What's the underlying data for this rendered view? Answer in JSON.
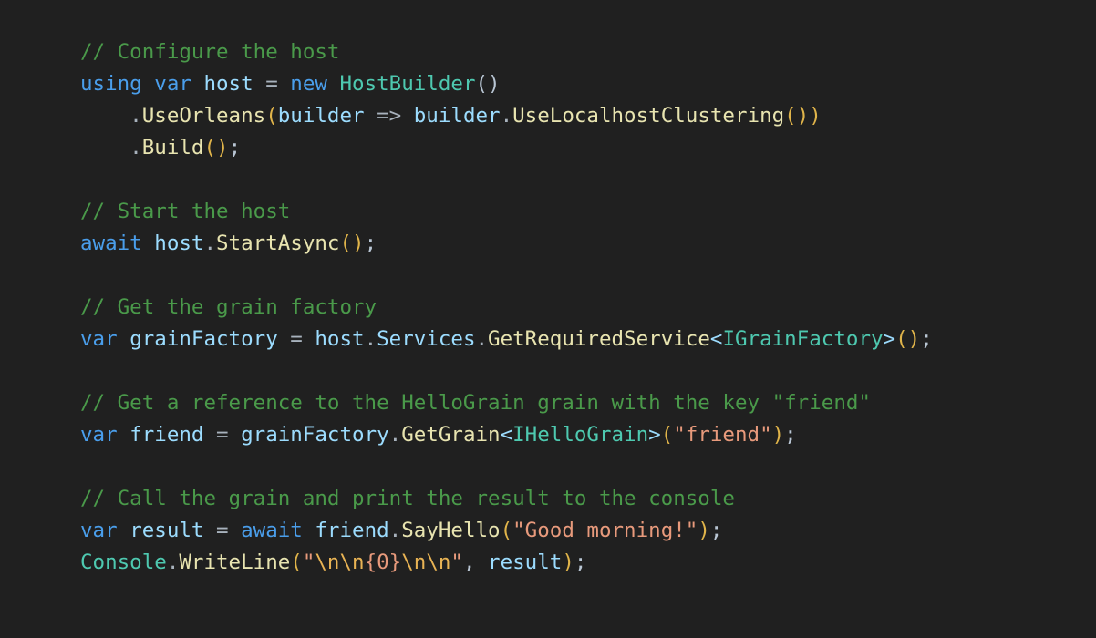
{
  "editor": {
    "background_color": "#202020",
    "language": "csharp",
    "palette": {
      "comment": "#4a9a4a",
      "keyword": "#4a9eeb",
      "variable": "#9cdcfe",
      "type": "#4ec9b0",
      "method": "#e8e4b0",
      "string": "#e89a7c",
      "escape": "#e8b354",
      "paren": "#e0b44a",
      "punctuation": "#b9c6d4",
      "operator": "#a8b2bd"
    }
  },
  "code": {
    "lines": [
      {
        "id": "line-1",
        "tokens": [
          {
            "t": "// Configure the host",
            "c": "comment"
          }
        ]
      },
      {
        "id": "line-2",
        "tokens": [
          {
            "t": "using",
            "c": "keyword"
          },
          {
            "t": " ",
            "c": "plain"
          },
          {
            "t": "var",
            "c": "keyword"
          },
          {
            "t": " ",
            "c": "plain"
          },
          {
            "t": "host",
            "c": "var"
          },
          {
            "t": " ",
            "c": "plain"
          },
          {
            "t": "=",
            "c": "op"
          },
          {
            "t": " ",
            "c": "plain"
          },
          {
            "t": "new",
            "c": "keyword"
          },
          {
            "t": " ",
            "c": "plain"
          },
          {
            "t": "HostBuilder",
            "c": "type"
          },
          {
            "t": "(",
            "c": "punct"
          },
          {
            "t": ")",
            "c": "punct"
          }
        ]
      },
      {
        "id": "line-3",
        "tokens": [
          {
            "t": "    ",
            "c": "plain"
          },
          {
            "t": ".",
            "c": "op"
          },
          {
            "t": "UseOrleans",
            "c": "method"
          },
          {
            "t": "(",
            "c": "paren"
          },
          {
            "t": "builder",
            "c": "var"
          },
          {
            "t": " ",
            "c": "plain"
          },
          {
            "t": "=>",
            "c": "op"
          },
          {
            "t": " ",
            "c": "plain"
          },
          {
            "t": "builder",
            "c": "var"
          },
          {
            "t": ".",
            "c": "op"
          },
          {
            "t": "UseLocalhostClustering",
            "c": "method"
          },
          {
            "t": "(",
            "c": "paren"
          },
          {
            "t": ")",
            "c": "paren"
          },
          {
            "t": ")",
            "c": "paren"
          }
        ]
      },
      {
        "id": "line-4",
        "tokens": [
          {
            "t": "    ",
            "c": "plain"
          },
          {
            "t": ".",
            "c": "op"
          },
          {
            "t": "Build",
            "c": "method"
          },
          {
            "t": "(",
            "c": "paren"
          },
          {
            "t": ")",
            "c": "paren"
          },
          {
            "t": ";",
            "c": "punct"
          }
        ]
      },
      {
        "id": "line-5",
        "tokens": []
      },
      {
        "id": "line-6",
        "tokens": [
          {
            "t": "// Start the host",
            "c": "comment"
          }
        ]
      },
      {
        "id": "line-7",
        "tokens": [
          {
            "t": "await",
            "c": "keyword"
          },
          {
            "t": " ",
            "c": "plain"
          },
          {
            "t": "host",
            "c": "var"
          },
          {
            "t": ".",
            "c": "op"
          },
          {
            "t": "StartAsync",
            "c": "method"
          },
          {
            "t": "(",
            "c": "paren"
          },
          {
            "t": ")",
            "c": "paren"
          },
          {
            "t": ";",
            "c": "punct"
          }
        ]
      },
      {
        "id": "line-8",
        "tokens": []
      },
      {
        "id": "line-9",
        "tokens": [
          {
            "t": "// Get the grain factory",
            "c": "comment"
          }
        ]
      },
      {
        "id": "line-10",
        "tokens": [
          {
            "t": "var",
            "c": "keyword"
          },
          {
            "t": " ",
            "c": "plain"
          },
          {
            "t": "grainFactory",
            "c": "var"
          },
          {
            "t": " ",
            "c": "plain"
          },
          {
            "t": "=",
            "c": "op"
          },
          {
            "t": " ",
            "c": "plain"
          },
          {
            "t": "host",
            "c": "var"
          },
          {
            "t": ".",
            "c": "op"
          },
          {
            "t": "Services",
            "c": "var"
          },
          {
            "t": ".",
            "c": "op"
          },
          {
            "t": "GetRequiredService",
            "c": "method"
          },
          {
            "t": "<",
            "c": "var"
          },
          {
            "t": "IGrainFactory",
            "c": "type"
          },
          {
            "t": ">",
            "c": "var"
          },
          {
            "t": "(",
            "c": "paren"
          },
          {
            "t": ")",
            "c": "paren"
          },
          {
            "t": ";",
            "c": "punct"
          }
        ]
      },
      {
        "id": "line-11",
        "tokens": []
      },
      {
        "id": "line-12",
        "tokens": [
          {
            "t": "// Get a reference to the HelloGrain grain with the key \"friend\"",
            "c": "comment"
          }
        ]
      },
      {
        "id": "line-13",
        "tokens": [
          {
            "t": "var",
            "c": "keyword"
          },
          {
            "t": " ",
            "c": "plain"
          },
          {
            "t": "friend",
            "c": "var"
          },
          {
            "t": " ",
            "c": "plain"
          },
          {
            "t": "=",
            "c": "op"
          },
          {
            "t": " ",
            "c": "plain"
          },
          {
            "t": "grainFactory",
            "c": "var"
          },
          {
            "t": ".",
            "c": "op"
          },
          {
            "t": "GetGrain",
            "c": "method"
          },
          {
            "t": "<",
            "c": "var"
          },
          {
            "t": "IHelloGrain",
            "c": "type"
          },
          {
            "t": ">",
            "c": "var"
          },
          {
            "t": "(",
            "c": "paren"
          },
          {
            "t": "\"friend\"",
            "c": "string"
          },
          {
            "t": ")",
            "c": "paren"
          },
          {
            "t": ";",
            "c": "punct"
          }
        ]
      },
      {
        "id": "line-14",
        "tokens": []
      },
      {
        "id": "line-15",
        "tokens": [
          {
            "t": "// Call the grain and print the result to the console",
            "c": "comment"
          }
        ]
      },
      {
        "id": "line-16",
        "tokens": [
          {
            "t": "var",
            "c": "keyword"
          },
          {
            "t": " ",
            "c": "plain"
          },
          {
            "t": "result",
            "c": "var"
          },
          {
            "t": " ",
            "c": "plain"
          },
          {
            "t": "=",
            "c": "op"
          },
          {
            "t": " ",
            "c": "plain"
          },
          {
            "t": "await",
            "c": "keyword"
          },
          {
            "t": " ",
            "c": "plain"
          },
          {
            "t": "friend",
            "c": "var"
          },
          {
            "t": ".",
            "c": "op"
          },
          {
            "t": "SayHello",
            "c": "method"
          },
          {
            "t": "(",
            "c": "paren"
          },
          {
            "t": "\"Good morning!\"",
            "c": "string"
          },
          {
            "t": ")",
            "c": "paren"
          },
          {
            "t": ";",
            "c": "punct"
          }
        ]
      },
      {
        "id": "line-17",
        "tokens": [
          {
            "t": "Console",
            "c": "type"
          },
          {
            "t": ".",
            "c": "op"
          },
          {
            "t": "WriteLine",
            "c": "method"
          },
          {
            "t": "(",
            "c": "paren"
          },
          {
            "t": "\"",
            "c": "string"
          },
          {
            "t": "\\n",
            "c": "escape"
          },
          {
            "t": "\\n",
            "c": "escape"
          },
          {
            "t": "{0}",
            "c": "string"
          },
          {
            "t": "\\n",
            "c": "escape"
          },
          {
            "t": "\\n",
            "c": "escape"
          },
          {
            "t": "\"",
            "c": "string"
          },
          {
            "t": ",",
            "c": "punct"
          },
          {
            "t": " ",
            "c": "plain"
          },
          {
            "t": "result",
            "c": "var"
          },
          {
            "t": ")",
            "c": "paren"
          },
          {
            "t": ";",
            "c": "punct"
          }
        ]
      }
    ]
  }
}
